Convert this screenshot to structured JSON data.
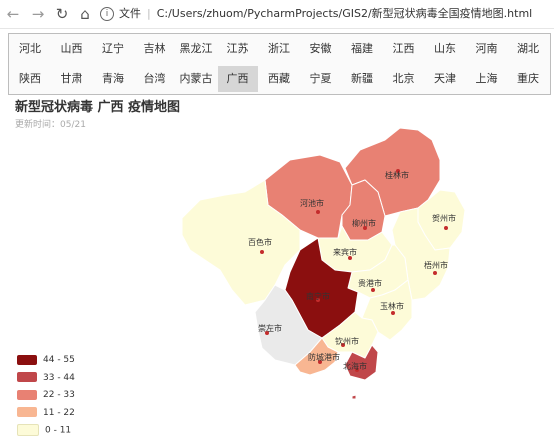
{
  "browser": {
    "file_label": "文件",
    "url": "C:/Users/zhuom/PycharmProjects/GIS2/新型冠状病毒全国疫情地图.html"
  },
  "provinces_row1": [
    "河北",
    "山西",
    "辽宁",
    "吉林",
    "黑龙江",
    "江苏",
    "浙江",
    "安徽",
    "福建",
    "江西",
    "山东",
    "河南",
    "湖北"
  ],
  "provinces_row2": [
    "陕西",
    "甘肃",
    "青海",
    "台湾",
    "内蒙古",
    "广西",
    "西藏",
    "宁夏",
    "新疆",
    "北京",
    "天津",
    "上海",
    "重庆"
  ],
  "active_province": "广西",
  "map": {
    "title": "新型冠状病毒 广西 疫情地图",
    "subtitle": "更新时间：05/21"
  },
  "legend": [
    {
      "label": "44 - 55",
      "color": "#8b0f0f"
    },
    {
      "label": "33 - 44",
      "color": "#c0474a"
    },
    {
      "label": "22 - 33",
      "color": "#e88173"
    },
    {
      "label": "11 - 22",
      "color": "#f8b692"
    },
    {
      "label": "0 - 11",
      "color": "#fdfbd8"
    }
  ],
  "cities": [
    {
      "name": "桂林市",
      "color": "#e88173"
    },
    {
      "name": "河池市",
      "color": "#e88173"
    },
    {
      "name": "柳州市",
      "color": "#e88173"
    },
    {
      "name": "贺州市",
      "color": "#fdfbd8"
    },
    {
      "name": "百色市",
      "color": "#fdfbd8"
    },
    {
      "name": "来宾市",
      "color": "#fdfbd8"
    },
    {
      "name": "梧州市",
      "color": "#fdfbd8"
    },
    {
      "name": "贵港市",
      "color": "#fdfbd8"
    },
    {
      "name": "南宁市",
      "color": "#8b0f0f"
    },
    {
      "name": "玉林市",
      "color": "#fdfbd8"
    },
    {
      "name": "崇左市",
      "color": "#eaeaea"
    },
    {
      "name": "钦州市",
      "color": "#fdfbd8"
    },
    {
      "name": "防城港市",
      "color": "#f8b692"
    },
    {
      "name": "北海市",
      "color": "#c0474a"
    }
  ]
}
